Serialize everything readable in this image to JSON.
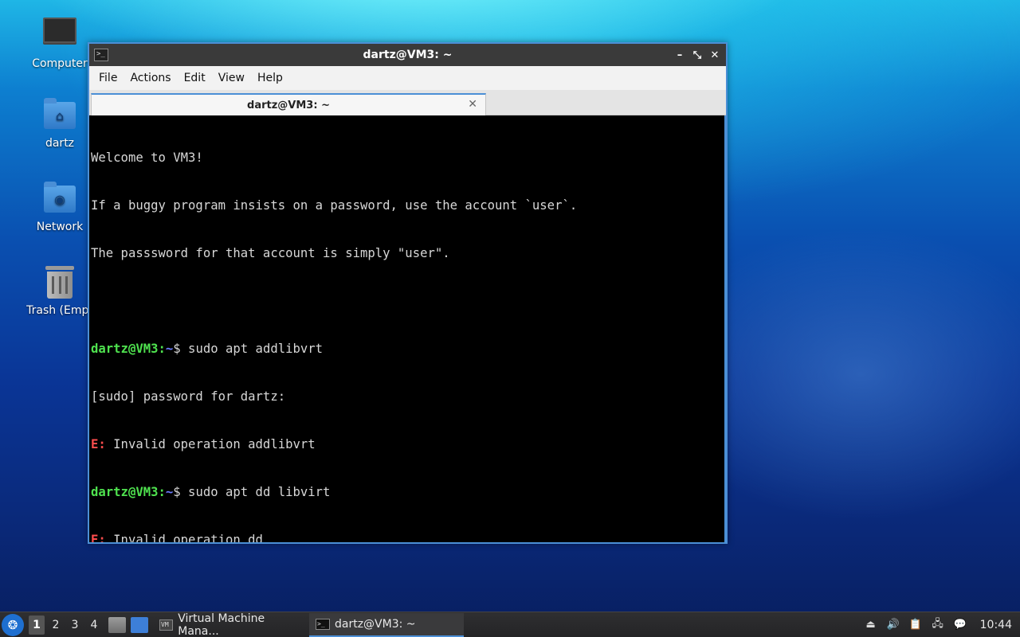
{
  "desktop": {
    "icons": [
      {
        "label": "Computer",
        "icon": "computer-icon"
      },
      {
        "label": "dartz",
        "icon": "home-folder-icon"
      },
      {
        "label": "Network",
        "icon": "network-folder-icon"
      },
      {
        "label": "Trash (Empt",
        "icon": "trash-icon"
      }
    ]
  },
  "window": {
    "title": "dartz@VM3: ~",
    "controls": {
      "minimize": "–",
      "maximize": "⤡",
      "close": "✕"
    },
    "menu": [
      "File",
      "Actions",
      "Edit",
      "View",
      "Help"
    ],
    "tab": {
      "label": "dartz@VM3: ~",
      "close": "✕"
    }
  },
  "terminal": {
    "lines": [
      "Welcome to VM3!",
      "If a buggy program insists on a password, use the account `user`.",
      "The passsword for that account is simply \"user\".",
      ""
    ],
    "prompt": {
      "user_host": "dartz@VM3",
      "sep": ":",
      "path": "~",
      "symbol": "$"
    },
    "cmd1": " sudo apt addlibvrt",
    "sudo_prompt": "[sudo] password for dartz:",
    "err_prefix": "E:",
    "err1": " Invalid operation addlibvrt",
    "cmd2": " sudo apt dd libvirt",
    "err2": " Invalid operation dd",
    "cmd3": " "
  },
  "taskbar": {
    "workspaces": [
      "1",
      "2",
      "3",
      "4"
    ],
    "tasks": [
      {
        "label": "Virtual Machine Mana..."
      },
      {
        "label": "dartz@VM3: ~"
      }
    ],
    "clock": "10:44"
  }
}
